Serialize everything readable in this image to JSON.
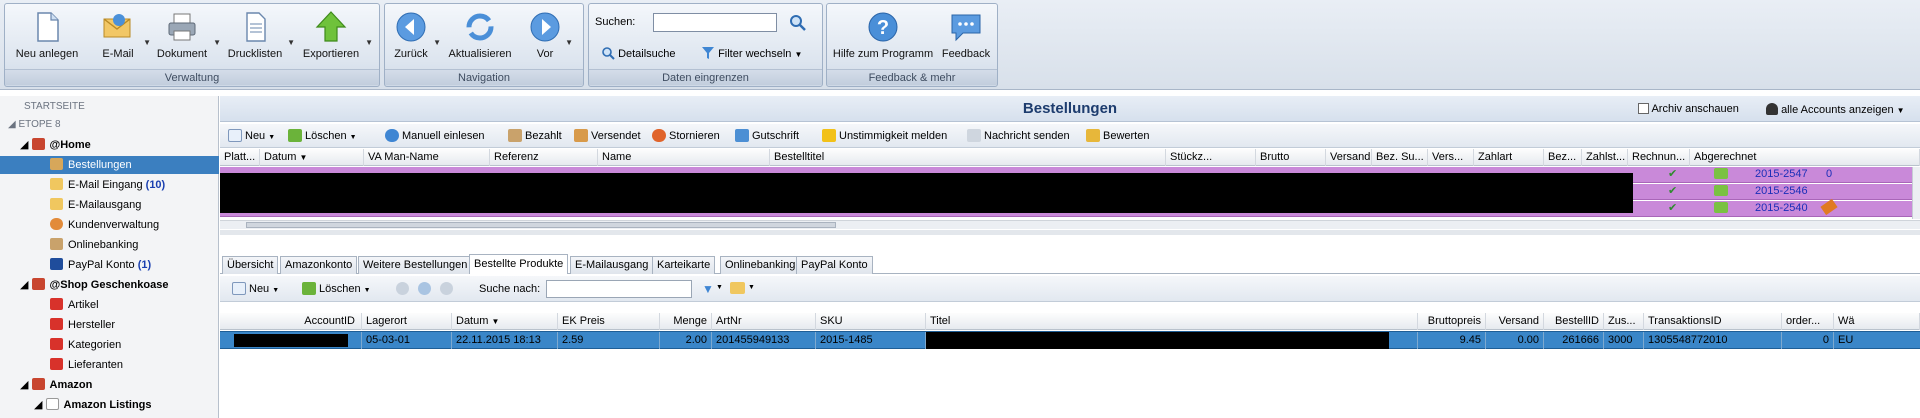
{
  "ribbon": {
    "groups": [
      {
        "label": "Verwaltung",
        "buttons": [
          {
            "label": "Neu anlegen",
            "icon": "new-document-icon"
          },
          {
            "label": "E-Mail",
            "icon": "email-icon"
          },
          {
            "label": "Dokument",
            "icon": "printer-icon"
          },
          {
            "label": "Drucklisten",
            "icon": "print-list-icon"
          },
          {
            "label": "Exportieren",
            "icon": "export-arrow-icon"
          }
        ]
      },
      {
        "label": "Navigation",
        "buttons": [
          {
            "label": "Zurück",
            "icon": "back-arrow-icon"
          },
          {
            "label": "Aktualisieren",
            "icon": "refresh-icon"
          },
          {
            "label": "Vor",
            "icon": "forward-arrow-icon"
          }
        ]
      },
      {
        "label": "Daten eingrenzen",
        "search_label": "Suchen:",
        "search_value": "",
        "detail_search": "Detailsuche",
        "filter": "Filter wechseln"
      },
      {
        "label": "Feedback & mehr",
        "buttons": [
          {
            "label": "Hilfe zum Programm",
            "icon": "help-icon"
          },
          {
            "label": "Feedback",
            "icon": "feedback-icon"
          }
        ]
      }
    ]
  },
  "sidebar": {
    "start": "STARTSEITE",
    "root": "ETOPE 8",
    "home": "@Home",
    "home_items": [
      {
        "label": "Bestellungen",
        "count": ""
      },
      {
        "label": "E-Mail Eingang",
        "count": "(10)"
      },
      {
        "label": "E-Mailausgang",
        "count": ""
      },
      {
        "label": "Kundenverwaltung",
        "count": ""
      },
      {
        "label": "Onlinebanking",
        "count": ""
      },
      {
        "label": "PayPal Konto",
        "count": "(1)"
      }
    ],
    "shop": "@Shop Geschenkoase",
    "shop_items": [
      "Artikel",
      "Hersteller",
      "Kategorien",
      "Lieferanten"
    ],
    "amazon": "Amazon",
    "amazon_listings": "Amazon Listings"
  },
  "main": {
    "title": "Bestellungen",
    "archive": "Archiv anschauen",
    "accounts": "alle Accounts anzeigen",
    "toolbar": [
      "Neu",
      "Löschen",
      "Manuell einlesen",
      "Bezahlt",
      "Versendet",
      "Stornieren",
      "Gutschrift",
      "Unstimmigkeit melden",
      "Nachricht senden",
      "Bewerten"
    ],
    "order_columns": [
      "Platt...",
      "Datum",
      "VA Man-Name",
      "Referenz",
      "Name",
      "Bestelltitel",
      "Stückz...",
      "Brutto",
      "Versand",
      "Bez. Su...",
      "Vers...",
      "Zahlart",
      "Bez...",
      "Zahlst...",
      "Rechnun...",
      "Abgerechnet"
    ],
    "order_rows": [
      {
        "invoice": "2015-2547",
        "extra": "0"
      },
      {
        "invoice": "2015-2546",
        "extra": ""
      },
      {
        "invoice": "2015-2540",
        "extra": ""
      }
    ],
    "tabs": [
      "Übersicht",
      "Amazonkonto",
      "Weitere Bestellungen",
      "Bestellte Produkte",
      "E-Mailausgang",
      "Karteikarte",
      "Onlinebanking",
      "PayPal Konto"
    ],
    "active_tab": "Bestellte Produkte",
    "detail_toolbar": {
      "new": "Neu",
      "delete": "Löschen",
      "search_label": "Suche nach:",
      "search_value": ""
    },
    "product_columns": [
      "AccountID",
      "Lagerort",
      "Datum",
      "EK Preis",
      "Menge",
      "ArtNr",
      "SKU",
      "Titel",
      "Bruttopreis",
      "Versand",
      "BestellID",
      "Zus...",
      "TransaktionsID",
      "order...",
      "Wä"
    ],
    "product_row": {
      "accountid": "",
      "lagerort": "05-03-01",
      "datum": "22.11.2015 18:13",
      "ek_preis": "2.59",
      "menge": "2.00",
      "artnr": "201455949133",
      "sku": "2015-1485",
      "titel": "",
      "bruttopreis": "9.45",
      "versand": "0.00",
      "bestellid": "261666",
      "zus": "3000",
      "transaktionsid": "1305548772010",
      "order": "0",
      "waehrung": "EU"
    }
  },
  "colors": {
    "accent": "#3b7fc0",
    "row_purple": "#c77fd6",
    "selected_row": "#3a86c8",
    "redaction": "#000000"
  }
}
